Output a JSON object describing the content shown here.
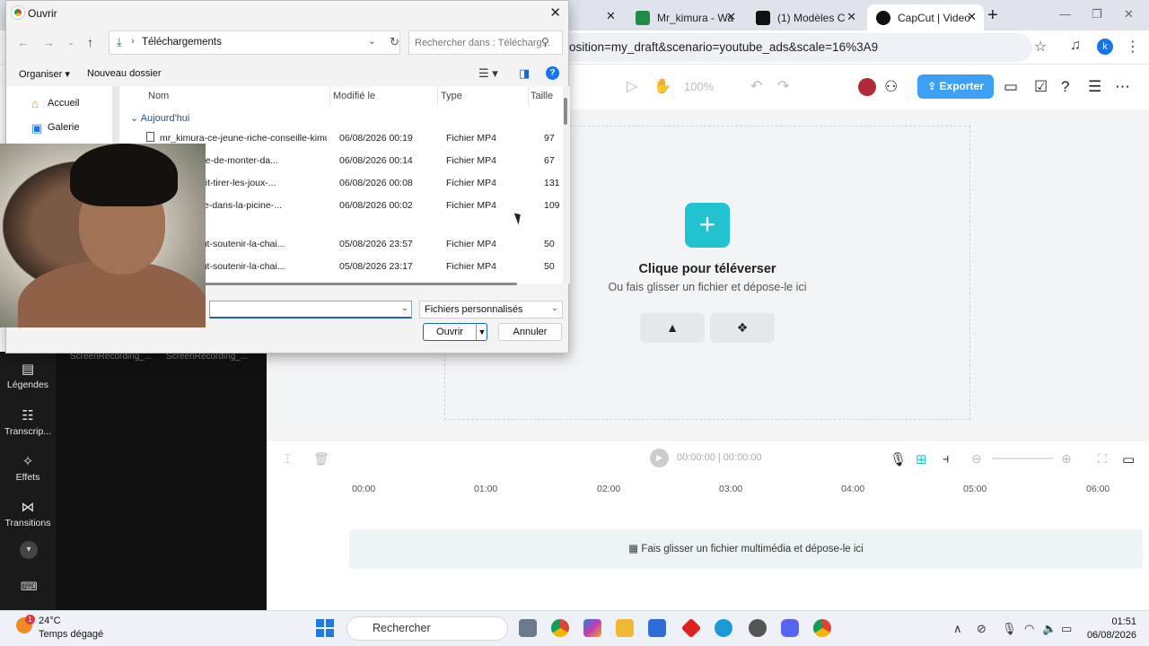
{
  "browser": {
    "tabs": [
      {
        "label": "Mr_kimura - Wa",
        "favicon_color": "#1f8b4c"
      },
      {
        "label": "(1) Modèles C",
        "favicon_color": "#111111"
      },
      {
        "label": "CapCut | Video",
        "favicon_color": "#111111"
      }
    ],
    "url": "osition=my_draft&scenario=youtube_ads&scale=16%3A9",
    "profile_initial": "k"
  },
  "capcut": {
    "zoom": "100%",
    "export_label": "Exporter",
    "accent": "#3ea0f5",
    "upload_title": "Clique pour téléverser",
    "upload_sub": "Ou fais glisser un fichier et dépose-le ici",
    "rail": [
      {
        "label": "Légendes",
        "icon": "captions-icon"
      },
      {
        "label": "Transcrip...",
        "icon": "transcript-icon"
      },
      {
        "label": "Effets",
        "icon": "effects-icon"
      },
      {
        "label": "Transitions",
        "icon": "transitions-icon"
      }
    ],
    "media_labels": [
      "ScreenRecording_...",
      "ScreenRecording_..."
    ],
    "timecode": "00:00:00 | 00:00:00",
    "ruler": [
      "00:00",
      "01:00",
      "02:00",
      "03:00",
      "04:00",
      "05:00",
      "06:00"
    ],
    "track_drop": "Fais glisser un fichier multimédia et dépose-le ici"
  },
  "dialog": {
    "title": "Ouvrir",
    "address": "Téléchargements",
    "search_placeholder": "Rechercher dans : Télécharg...",
    "organize": "Organiser ▾",
    "new_folder": "Nouveau dossier",
    "nav": [
      {
        "label": "Accueil",
        "icon": "home-icon"
      },
      {
        "label": "Galerie",
        "icon": "gallery-icon"
      }
    ],
    "columns": {
      "name": "Nom",
      "modified": "Modifié le",
      "type": "Type",
      "size": "Taille"
    },
    "group": "Aujourd'hui",
    "files": [
      {
        "name": "mr_kimura-ce-jeune-riche-conseille-kimu...",
        "date": "06/08/2026 00:19",
        "type": "Fichier MP4",
        "size": "97"
      },
      {
        "name": "mure-refuse-de-monter-da...",
        "date": "06/08/2026 00:14",
        "type": "Fichier MP4",
        "size": "67"
      },
      {
        "name": "mura-ce-fait-tirer-les-joux-...",
        "date": "06/08/2026 00:08",
        "type": "Fichier MP4",
        "size": "131"
      },
      {
        "name": "mura-rentre-dans-la-picine-...",
        "date": "06/08/2026 00:02",
        "type": "Fichier MP4",
        "size": "109"
      },
      {
        "name": "aspard-veut-soutenir-la-chai...",
        "date": "05/08/2026 23:57",
        "type": "Fichier MP4",
        "size": "50"
      },
      {
        "name": "aspard-veut-soutenir-la-chai...",
        "date": "05/08/2026 23:17",
        "type": "Fichier MP4",
        "size": "50"
      }
    ],
    "filter": "Fichiers personnalisés",
    "open_label": "Ouvrir",
    "cancel_label": "Annuler"
  },
  "taskbar": {
    "temp": "24°C",
    "weather": "Temps dégagé",
    "weather_badge": "1",
    "search": "Rechercher",
    "time": "01:51",
    "date": "06/08/2026"
  }
}
